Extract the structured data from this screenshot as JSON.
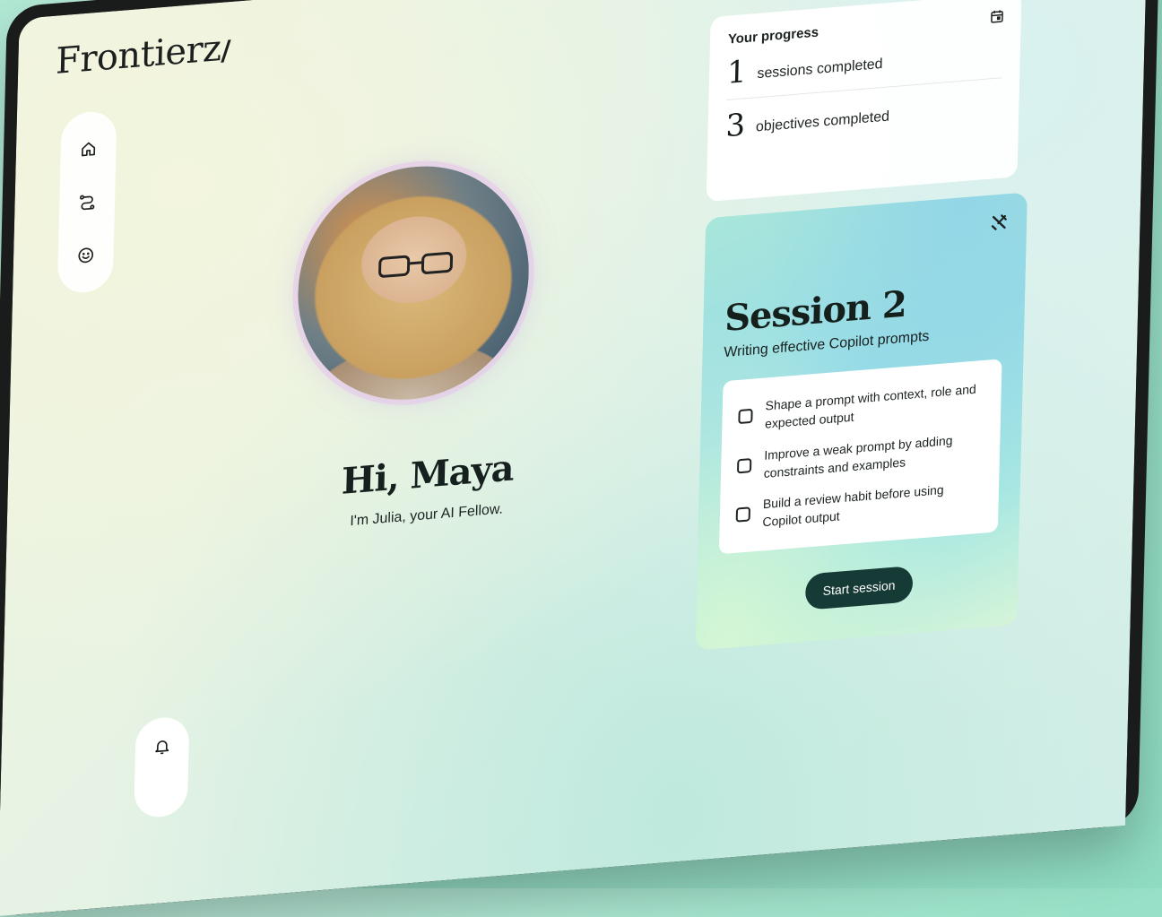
{
  "brand": {
    "name": "Frontierz",
    "mark": "/"
  },
  "nav": {
    "items": [
      "home",
      "journey",
      "profile"
    ]
  },
  "greeting": {
    "title": "Hi, Maya",
    "intro": "I'm Julia, your AI Fellow."
  },
  "progress": {
    "title": "Your progress",
    "stats": [
      {
        "value": "1",
        "label": "sessions completed"
      },
      {
        "value": "3",
        "label": "objectives completed"
      }
    ]
  },
  "session": {
    "title": "Session 2",
    "subtitle": "Writing effective Copilot prompts",
    "objectives": [
      "Shape a prompt with context, role and expected output",
      "Improve a weak prompt by adding constraints and examples",
      "Build a review habit before using Copilot output"
    ],
    "cta": "Start session"
  },
  "colors": {
    "accent": "#163a36",
    "background": "#9fe3cb"
  },
  "icons": [
    "home-icon",
    "route-icon",
    "smiley-icon",
    "bell-icon",
    "calendar-icon",
    "tools-icon"
  ]
}
